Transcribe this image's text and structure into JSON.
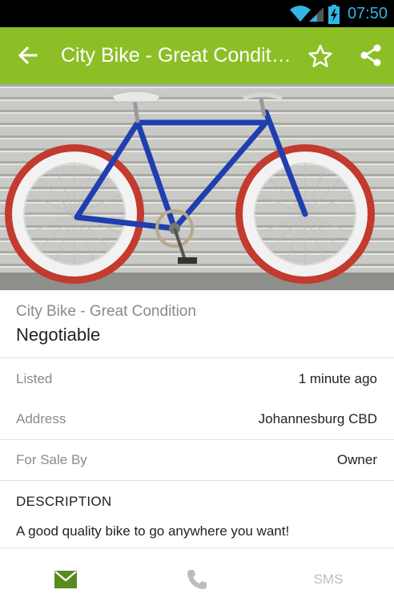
{
  "status_bar": {
    "time": "07:50",
    "time_color": "#33b5e5"
  },
  "app_bar": {
    "title": "City Bike - Great Condition",
    "color": "#8cbf26",
    "icons": [
      "arrow-back-icon",
      "star-outline-icon",
      "share-icon"
    ]
  },
  "listing": {
    "title": "City Bike - Great Condition",
    "price": "Negotiable",
    "details": [
      {
        "key": "Listed",
        "value": "1 minute ago"
      },
      {
        "key": "Address",
        "value": "Johannesburg CBD"
      },
      {
        "key": "For Sale By",
        "value": "Owner"
      }
    ],
    "description_heading": "DESCRIPTION",
    "description": "A good quality bike to go anywhere you want!"
  },
  "bottom_actions": {
    "email_icon": "email-icon",
    "call_icon": "phone-icon",
    "sms_label": "SMS",
    "active_color": "#5a8a1e",
    "inactive_color": "#bdbdbd"
  }
}
